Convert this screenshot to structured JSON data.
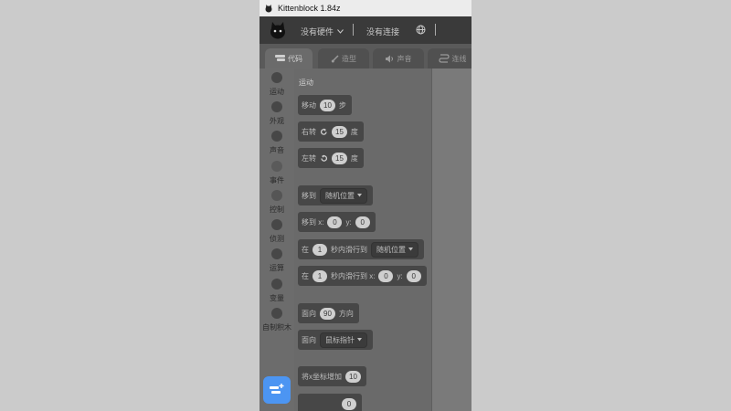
{
  "window": {
    "title": "Kittenblock 1.84z"
  },
  "menubar": {
    "hardware_label": "没有硬件",
    "connection_label": "没有连接",
    "globe_icon": "globe-icon"
  },
  "tabs": [
    {
      "label": "代码",
      "icon": "code-icon",
      "active": true
    },
    {
      "label": "造型",
      "icon": "brush-icon",
      "active": false
    },
    {
      "label": "声音",
      "icon": "speaker-icon",
      "active": false
    },
    {
      "label": "连线",
      "icon": "wire-icon",
      "active": false
    }
  ],
  "categories": [
    "运动",
    "外观",
    "声音",
    "事件",
    "控制",
    "侦测",
    "运算",
    "变量",
    "自制积木"
  ],
  "palette": {
    "section_title": "运动",
    "blocks": {
      "move": {
        "label": "移动",
        "value": "10",
        "suffix": "步"
      },
      "turn_right": {
        "label": "右转",
        "value": "15",
        "suffix": "度"
      },
      "turn_left": {
        "label": "左转",
        "value": "15",
        "suffix": "度"
      },
      "goto": {
        "label": "移到",
        "dropdown": "随机位置"
      },
      "goto_xy": {
        "label": "移到 x:",
        "x": "0",
        "y_label": "y:",
        "y": "0"
      },
      "glide": {
        "label": "在",
        "secs": "1",
        "mid": "秒内滑行到",
        "dropdown": "随机位置"
      },
      "glide_xy": {
        "label": "在",
        "secs": "1",
        "mid": "秒内滑行到 x:",
        "x": "0",
        "y_label": "y:",
        "y": "0"
      },
      "point_dir": {
        "label": "面向",
        "value": "90",
        "suffix": "方向"
      },
      "point_towards": {
        "label": "面向",
        "dropdown": "鼠标指针"
      },
      "change_x": {
        "label": "将x坐标增加",
        "value": "10"
      },
      "partial": {
        "value": "0"
      }
    }
  },
  "colors": {
    "extension_button": "#4c95f2",
    "overlay": "#6a6a6a"
  }
}
